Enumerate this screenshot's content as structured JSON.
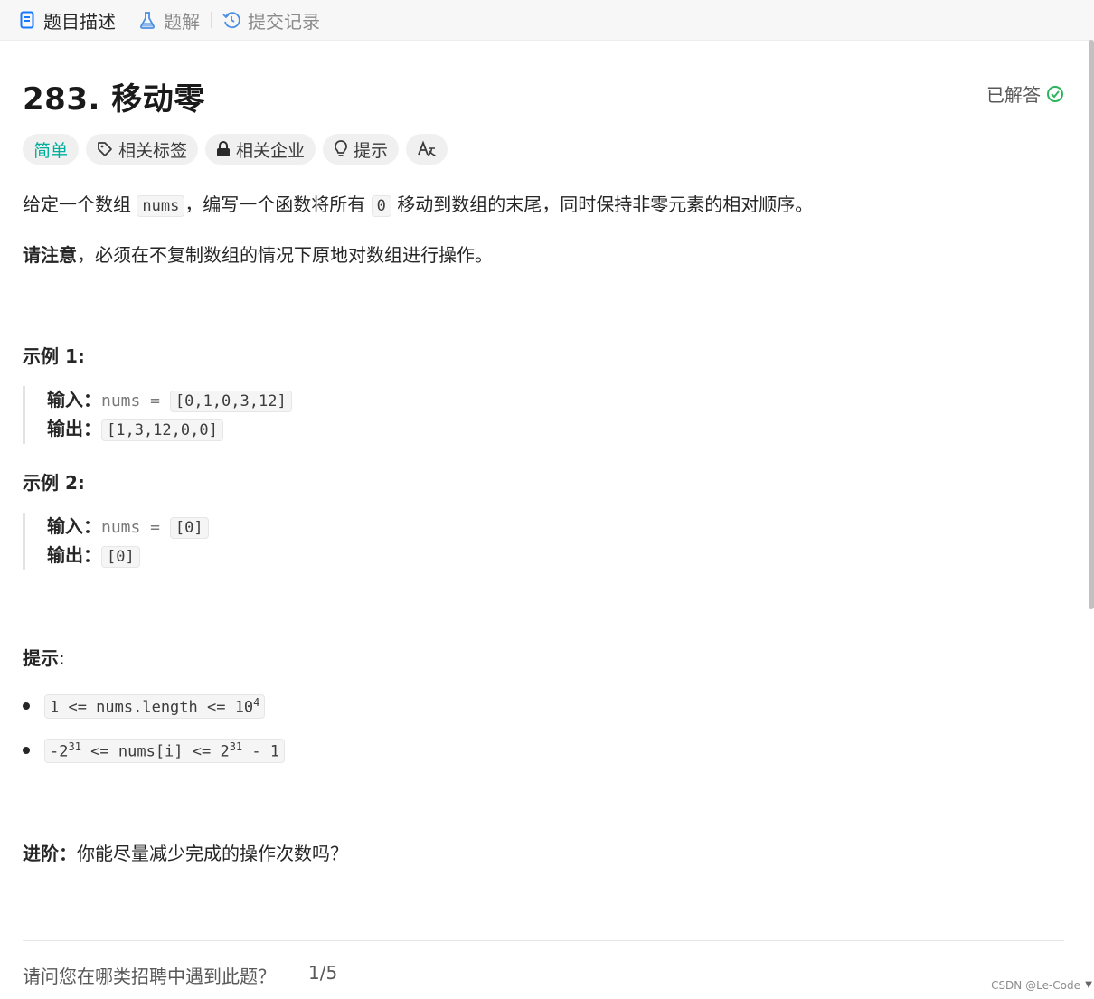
{
  "tabs": [
    {
      "label": "题目描述",
      "icon": "document-icon"
    },
    {
      "label": "题解",
      "icon": "flask-icon"
    },
    {
      "label": "提交记录",
      "icon": "history-icon"
    }
  ],
  "problem": {
    "title": "283. 移动零",
    "status": "已解答",
    "tags": [
      "简单",
      "相关标签",
      "相关企业",
      "提示",
      "A文"
    ],
    "desc_p1": "给定一个数组",
    "desc_code1": "nums",
    "desc_p2": "，编写一个函数将所有",
    "desc_code2": "0",
    "desc_p3": "移动到数组的末尾，同时保持非零元素的相对顺序。",
    "note_bold": "请注意",
    "note_text": "，必须在不复制数组的情况下原地对数组进行操作。"
  },
  "examples": [
    {
      "heading": "示例 1:",
      "in_label": "输入：",
      "in_var": "nums = ",
      "in_val": "[0,1,0,3,12]",
      "out_label": "输出：",
      "out_val": "[1,3,12,0,0]"
    },
    {
      "heading": "示例 2:",
      "in_label": "输入：",
      "in_var": "nums = ",
      "in_val": "[0]",
      "out_label": "输出：",
      "out_val": "[0]"
    }
  ],
  "hints": {
    "heading": "提示",
    "colon": ":",
    "c1_a": "1 <= nums.length <= 10",
    "c1_sup": "4",
    "c2_a": "-2",
    "c2_sup1": "31",
    "c2_b": " <= nums[i] <= 2",
    "c2_sup2": "31",
    "c2_c": " - 1"
  },
  "advanced": {
    "label": "进阶：",
    "text": "你能尽量减少完成的操作次数吗？"
  },
  "footer": {
    "question": "请问您在哪类招聘中遇到此题？",
    "page": "1/5"
  },
  "watermark": "CSDN @Le-Code",
  "colors": {
    "easy": "#00af9b",
    "solved": "#2db55d",
    "tab_active_icon": "#1677ff",
    "flask": "#4a90e2"
  }
}
